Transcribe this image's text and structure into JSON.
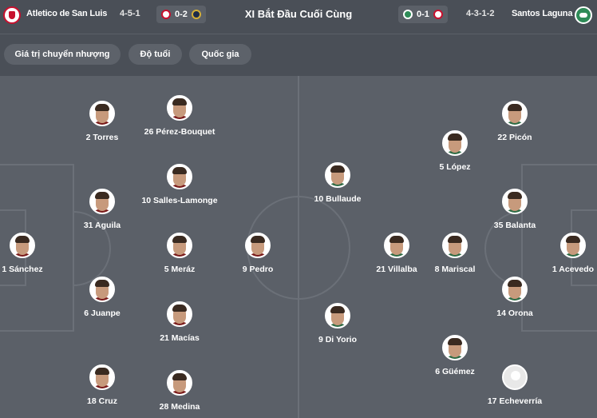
{
  "header": {
    "home_team": "Atletico de San Luis",
    "home_formation": "4-5-1",
    "home_last_score": "0-2",
    "title": "XI Bắt Đầu Cuối Cùng",
    "away_last_score": "0-1",
    "away_formation": "4-3-1-2",
    "away_team": "Santos Laguna"
  },
  "filters": [
    "Giá trị chuyển nhượng",
    "Độ tuổi",
    "Quốc gia"
  ],
  "home_players": [
    {
      "label": "2 Torres"
    },
    {
      "label": "26 Pérez-Bouquet"
    },
    {
      "label": "10 Salles-Lamonge"
    },
    {
      "label": "31 Aguila"
    },
    {
      "label": "1 Sánchez"
    },
    {
      "label": "5 Meráz"
    },
    {
      "label": "9 Pedro"
    },
    {
      "label": "6 Juanpe"
    },
    {
      "label": "21 Macías"
    },
    {
      "label": "18 Cruz"
    },
    {
      "label": "28 Medina"
    }
  ],
  "away_players": [
    {
      "label": "22 Picón"
    },
    {
      "label": "5 López"
    },
    {
      "label": "10 Bullaude"
    },
    {
      "label": "35 Balanta"
    },
    {
      "label": "21 Villalba"
    },
    {
      "label": "8 Mariscal"
    },
    {
      "label": "1 Acevedo"
    },
    {
      "label": "14 Orona"
    },
    {
      "label": "9 Di Yorio"
    },
    {
      "label": "6 Güémez"
    },
    {
      "label": "17 Echeverría"
    }
  ],
  "colors": {
    "home": "#c8102e",
    "away": "#2e8b57"
  }
}
